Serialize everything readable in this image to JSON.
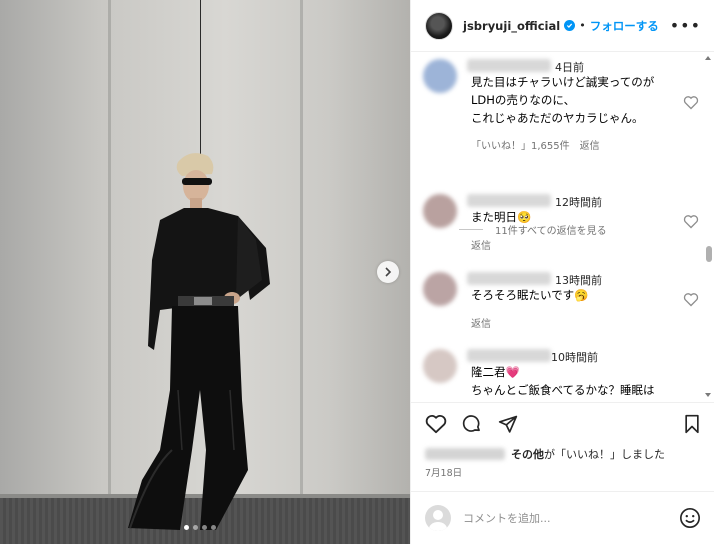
{
  "post": {
    "username": "jsbryuji_official",
    "separator": "•",
    "follow_label": "フォローする",
    "more_label": "•••"
  },
  "comments": [
    {
      "time": "4日前",
      "lines": [
        "見た目はチャラいけど誠実ってのが",
        "LDHの売りなのに、",
        "これじゃあただのヤカラじゃん。"
      ],
      "likes": "「いいね！」1,655件",
      "reply": "返信",
      "avatar_color": "#9db4d8"
    },
    {
      "time": "12時間前",
      "lines": [
        "また明日🥺"
      ],
      "reply": "返信",
      "avatar_color": "#b9a19f"
    },
    {
      "time": "13時間前",
      "lines": [
        "そろそろ眠たいです🥱"
      ],
      "reply": "返信",
      "avatar_color": "#bba4a4"
    },
    {
      "time": "10時間前",
      "lines": [
        "隆二君💗",
        "ちゃんとご飯食べてるかな？睡眠は"
      ],
      "avatar_color": "#d6c8c4"
    }
  ],
  "view_replies": "11件すべての返信を見る",
  "likes_summary": {
    "bold": "その他",
    "rest": "が「いいね！」しました"
  },
  "date": "7月18日",
  "add_comment": {
    "placeholder": "コメントを追加..."
  },
  "carousel": {
    "slide_count": 4,
    "active": 0
  },
  "colors": {
    "accent": "#0095f6",
    "muted": "#737373"
  }
}
